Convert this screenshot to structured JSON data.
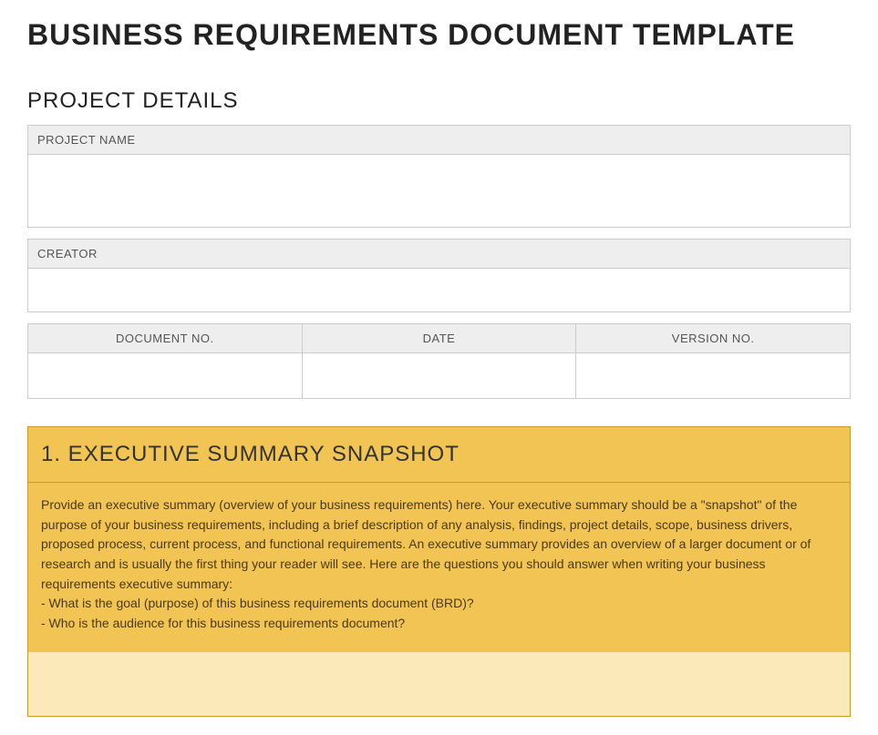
{
  "title": "BUSINESS REQUIREMENTS DOCUMENT TEMPLATE",
  "projectDetails": {
    "heading": "PROJECT DETAILS",
    "projectNameLabel": "PROJECT NAME",
    "creatorLabel": "CREATOR",
    "documentNoLabel": "DOCUMENT NO.",
    "dateLabel": "DATE",
    "versionNoLabel": "VERSION NO."
  },
  "executiveSummary": {
    "heading": "1. EXECUTIVE SUMMARY SNAPSHOT",
    "body": "Provide an executive summary (overview of your business requirements) here. Your executive summary should be a \"snapshot\" of the purpose of your business requirements, including a brief description of any analysis, findings, project details, scope, business drivers, proposed process, current process, and functional requirements. An executive summary provides an overview of a larger document or of research and is usually the first thing your reader will see. Here are the questions you should answer when writing your business requirements executive summary:\n- What is the goal (purpose) of this business requirements document (BRD)?\n- Who is the audience for this business requirements document?"
  }
}
